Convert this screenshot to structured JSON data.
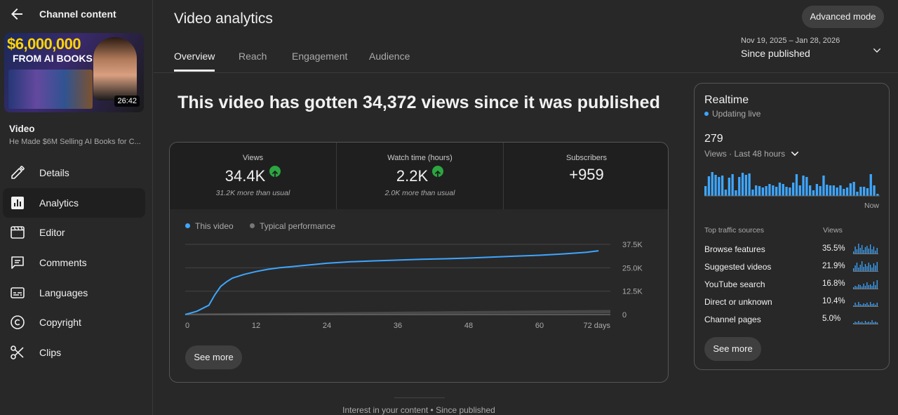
{
  "sidebar": {
    "title": "Channel content",
    "thumbnail": {
      "line1": "$6,000,000",
      "line2": "FROM AI BOOKS",
      "duration": "26:42"
    },
    "video_label": "Video",
    "video_name": "He Made $6M Selling AI Books for C...",
    "items": [
      {
        "label": "Details",
        "icon": "pencil-icon"
      },
      {
        "label": "Analytics",
        "icon": "analytics-icon"
      },
      {
        "label": "Editor",
        "icon": "editor-icon"
      },
      {
        "label": "Comments",
        "icon": "comments-icon"
      },
      {
        "label": "Languages",
        "icon": "subtitles-icon"
      },
      {
        "label": "Copyright",
        "icon": "copyright-icon"
      },
      {
        "label": "Clips",
        "icon": "scissors-icon"
      }
    ]
  },
  "header": {
    "title": "Video analytics",
    "advanced_mode": "Advanced mode",
    "tabs": [
      "Overview",
      "Reach",
      "Engagement",
      "Audience"
    ],
    "date_range": "Nov 19, 2025 – Jan 28, 2026",
    "period": "Since published"
  },
  "headline": "This video has gotten 34,372 views since it was published",
  "metrics": [
    {
      "label": "Views",
      "value": "34.4K",
      "sub": "31.2K more than usual",
      "up": true
    },
    {
      "label": "Watch time (hours)",
      "value": "2.2K",
      "sub": "2.0K more than usual",
      "up": true
    },
    {
      "label": "Subscribers",
      "value": "+959",
      "sub": "",
      "up": false
    }
  ],
  "legend": {
    "this_video": "This video",
    "typical": "Typical performance"
  },
  "colors": {
    "accent": "#3ea6ff",
    "line": "#3ea6ff",
    "up": "#2ba640",
    "typical": "#555555"
  },
  "see_more": "See more",
  "chart_data": {
    "type": "line",
    "xlabel": "",
    "ylabel": "",
    "x_ticks": [
      "0",
      "12",
      "24",
      "36",
      "48",
      "60",
      "72 days"
    ],
    "y_ticks": [
      "0",
      "12.5K",
      "25.0K",
      "37.5K"
    ],
    "ylim": [
      0,
      37500
    ],
    "xlim": [
      0,
      72
    ],
    "series": [
      {
        "name": "This video",
        "x": [
          0,
          2,
          4,
          5,
          6,
          7,
          8,
          10,
          12,
          14,
          16,
          18,
          20,
          24,
          28,
          32,
          36,
          40,
          44,
          48,
          52,
          56,
          60,
          64,
          68,
          70
        ],
        "y": [
          0,
          1800,
          5000,
          10500,
          15000,
          17500,
          19500,
          21500,
          23000,
          24200,
          25000,
          25600,
          26200,
          27400,
          28200,
          28700,
          29100,
          29500,
          29800,
          30200,
          30700,
          31200,
          31700,
          32400,
          33300,
          34100
        ]
      }
    ],
    "typical_band": {
      "x": [
        0,
        72
      ],
      "low": [
        0,
        700
      ],
      "high": [
        600,
        2500
      ]
    }
  },
  "realtime": {
    "title": "Realtime",
    "status": "Updating live",
    "count": "279",
    "period": "Views · Last 48 hours",
    "now": "Now",
    "bars": [
      14,
      28,
      34,
      30,
      27,
      29,
      9,
      26,
      31,
      8,
      27,
      33,
      30,
      32,
      9,
      15,
      14,
      12,
      14,
      17,
      15,
      13,
      19,
      17,
      13,
      12,
      19,
      31,
      15,
      29,
      27,
      15,
      8,
      17,
      14,
      29,
      16,
      15,
      15,
      12,
      15,
      10,
      12,
      18,
      20,
      6,
      13,
      13,
      11,
      31,
      15,
      3
    ],
    "sources_header": "Top traffic sources",
    "views_header": "Views",
    "sources": [
      {
        "name": "Browse features",
        "pct": "35.5%"
      },
      {
        "name": "Suggested videos",
        "pct": "21.9%"
      },
      {
        "name": "YouTube search",
        "pct": "16.8%"
      },
      {
        "name": "Direct or unknown",
        "pct": "10.4%"
      },
      {
        "name": "Channel pages",
        "pct": "5.0%"
      }
    ]
  },
  "footer": "Interest in your content • Since published"
}
